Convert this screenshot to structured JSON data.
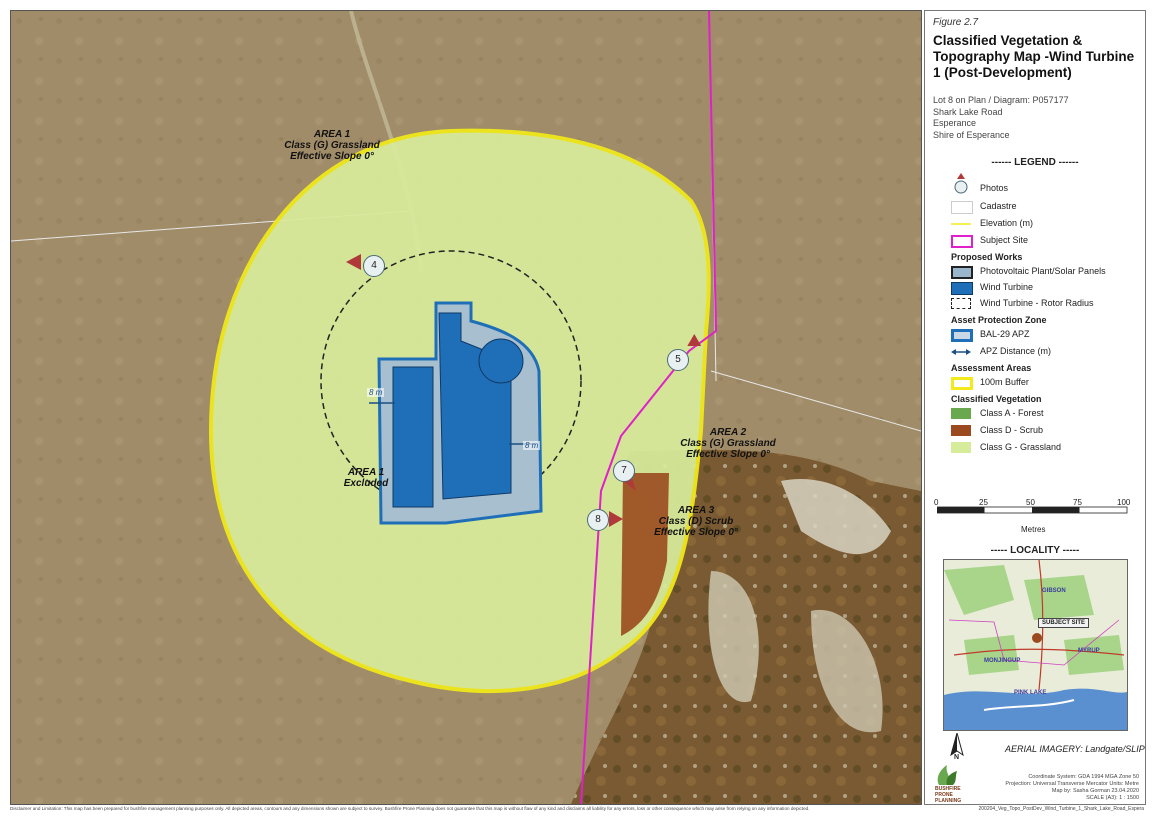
{
  "figure": {
    "number": "Figure 2.7",
    "title": "Classified Vegetation & Topography Map -Wind Turbine 1 (Post-Development)",
    "site_lines": [
      "Lot 8 on Plan / Diagram: P057177",
      "Shark Lake Road",
      "Esperance",
      "Shire of Esperance"
    ]
  },
  "map_labels": {
    "area1": [
      "AREA  1",
      "Class (G)  Grassland",
      "Effective Slope 0°"
    ],
    "area1_excluded": [
      "AREA  1",
      "Excluded"
    ],
    "area2": [
      "AREA  2",
      "Class (G)  Grassland",
      "Effective Slope 0°"
    ],
    "area3": [
      "AREA  3",
      "Class (D)  Scrub",
      "Effective Slope 0°"
    ],
    "apz_distance_1": "8 m",
    "apz_distance_2": "8 m"
  },
  "photo_points": [
    "4",
    "5",
    "7",
    "8"
  ],
  "legend": {
    "heading": "------ LEGEND ------",
    "items": {
      "photos": "Photos",
      "cadastre": "Cadastre",
      "elevation": "Elevation (m)",
      "subject_site": "Subject Site",
      "proposed_works": "Proposed Works",
      "pv_plant": "Photovoltaic Plant/Solar Panels",
      "wind_turbine": "Wind Turbine",
      "rotor_radius": "Wind Turbine - Rotor Radius",
      "apz_group": "Asset Protection Zone",
      "bal29": "BAL-29 APZ",
      "apz_distance": "APZ Distance (m)",
      "assessment_areas": "Assessment Areas",
      "buffer": "100m Buffer",
      "classified_veg": "Classified Vegetation",
      "class_a": "Class A - Forest",
      "class_d": "Class D - Scrub",
      "class_g": "Class G - Grassland"
    }
  },
  "scale_bar": {
    "ticks": [
      "0",
      "25",
      "50",
      "75",
      "100"
    ],
    "unit": "Metres"
  },
  "locality": {
    "heading": "----- LOCALITY -----",
    "labels": {
      "subject_site": "SUBJECT SITE",
      "gibson": "GIBSON",
      "monjingup": "MONJINGUP",
      "myrup": "MYRUP",
      "pink_lake": "PINK LAKE"
    }
  },
  "imagery_credit": "AERIAL IMAGERY: Landgate/SLIP",
  "north_arrow": "N",
  "coordinate_info": [
    "Coordinate System: GDA 1994 MGA Zone 50",
    "Projection: Universal Transverse Mercator   Units: Metre",
    "Map by: Sasha Gorman   23.04.2020",
    "SCALE (A3):  1 : 1500"
  ],
  "logo_text": "BUSHFIRE PRONE PLANNING",
  "disclaimer": "Disclaimer and Limitation: This map has been prepared for bushfire management planning purposes only. All depicted areas, contours and any dimensions shown are subject to survey. Bushfire Prone Planning does not guarantee that this map is without flaw of any kind and disclaims all liability for any errors, loss or other consequence which may arise from relying on any information depicted.",
  "filename": "200204_Veg_Topo_PostDev_Wind_Turbine_1_Shark_Lake_Road_Espera",
  "colors": {
    "grassland": "#d6ec9a",
    "scrub": "#9a4a1e",
    "forest": "#6aa84f",
    "buffer": "#f2ea1a",
    "subject_site": "#e020c8",
    "turbine": "#1f6fb8",
    "apz": "#9ab6cc"
  }
}
